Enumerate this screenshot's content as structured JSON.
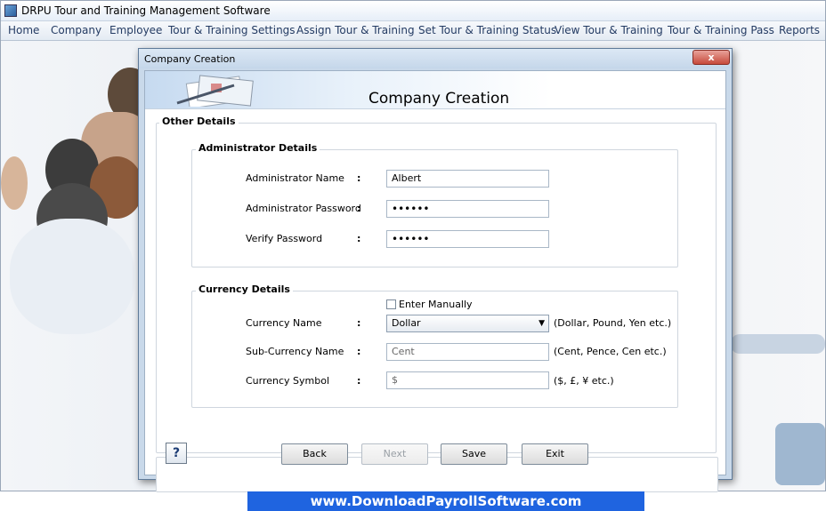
{
  "app": {
    "title": "DRPU Tour and Training Management Software"
  },
  "menu": [
    "Home",
    "Company",
    "Employee",
    "Tour & Training Settings",
    "Assign Tour & Training",
    "Set Tour & Training Status",
    "View Tour & Training",
    "Tour & Training Pass",
    "Reports"
  ],
  "dialog": {
    "title": "Company Creation",
    "close_label": "x",
    "banner_title": "Company Creation",
    "other_details_label": "Other Details",
    "admin": {
      "group_label": "Administrator Details",
      "name_label": "Administrator Name",
      "name_value": "Albert",
      "password_label": "Administrator Password",
      "password_value": "••••••",
      "verify_label": "Verify Password",
      "verify_value": "••••••",
      "colon": ":"
    },
    "currency": {
      "group_label": "Currency Details",
      "enter_manually_label": "Enter Manually",
      "enter_manually_checked": false,
      "name_label": "Currency Name",
      "name_value": "Dollar",
      "name_hint": "(Dollar, Pound, Yen etc.)",
      "sub_label": "Sub-Currency Name",
      "sub_value": "Cent",
      "sub_hint": "(Cent, Pence, Cen etc.)",
      "symbol_label": "Currency Symbol",
      "symbol_value": "$",
      "symbol_hint": "($, £, ¥ etc.)",
      "colon": ":"
    },
    "buttons": {
      "help": "?",
      "back": "Back",
      "next": "Next",
      "save": "Save",
      "exit": "Exit"
    }
  },
  "footer": {
    "url": "www.DownloadPayrollSoftware.com"
  },
  "colors": {
    "footer_bg": "#1f64e0",
    "close_red": "#c74a3b"
  }
}
